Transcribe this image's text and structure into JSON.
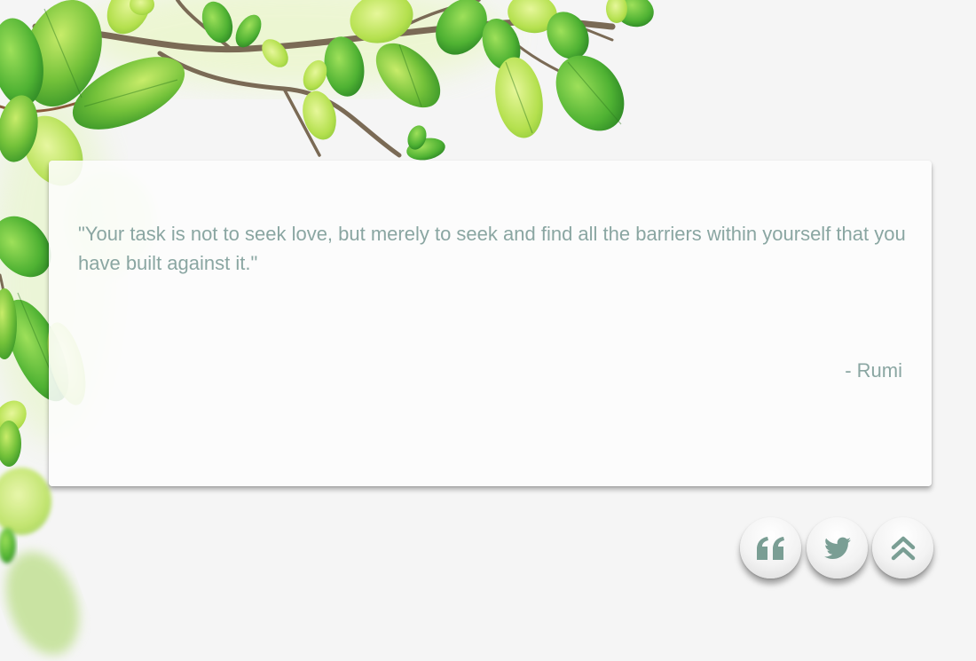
{
  "quote": {
    "text": "\"Your task is not to seek love, but merely to seek and find all the barriers within yourself that you have built against it.\"",
    "author": "- Rumi"
  },
  "actions": {
    "new_quote_icon": "quote-left-icon",
    "tweet_icon": "twitter-icon",
    "scroll_top_icon": "double-chevron-up-icon"
  },
  "colors": {
    "background": "#f5f5f5",
    "quote_text": "#8aa6a2",
    "icon": "#7a9e94",
    "leaf_green": "#7cc63a"
  }
}
